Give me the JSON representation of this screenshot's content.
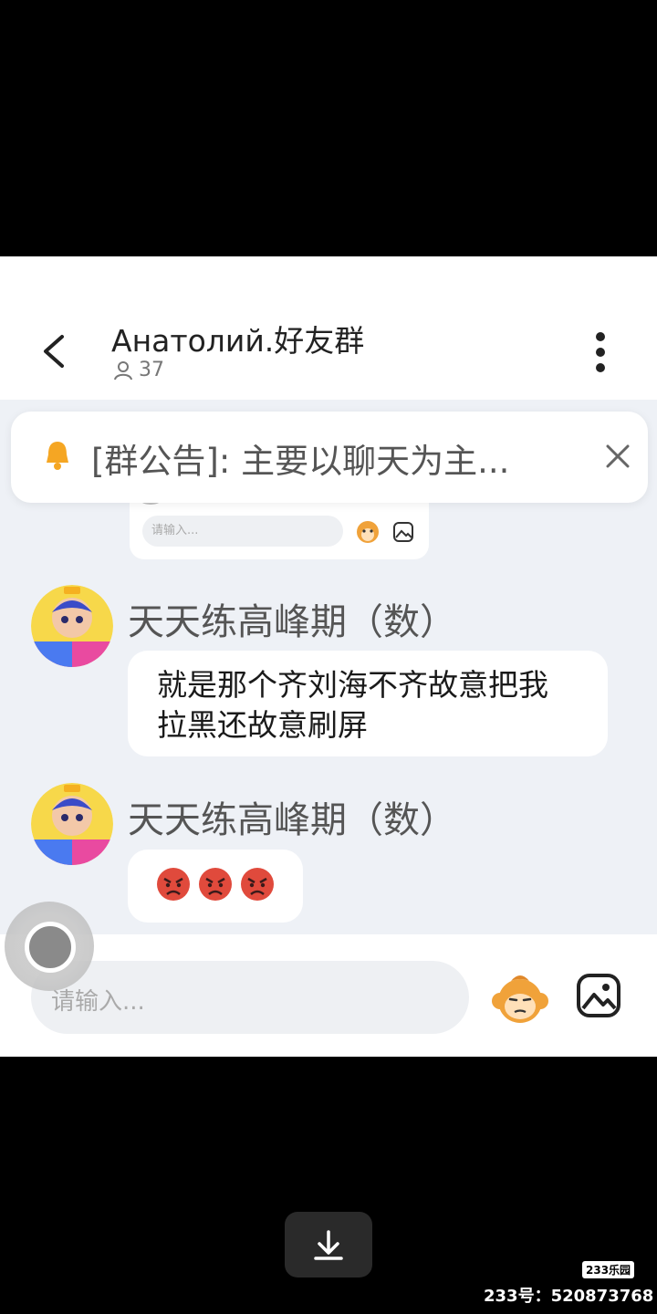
{
  "header": {
    "title": "Анатолий.好友群",
    "member_count": "37"
  },
  "notice": {
    "text": "[群公告]: 主要以聊天为主..."
  },
  "embedded_screenshot": {
    "input_placeholder": "请输入..."
  },
  "messages": [
    {
      "sender": "天天练高峰期（数）",
      "text": "就是那个齐刘海不齐故意把我\n拉黑还故意刷屏"
    },
    {
      "sender": "天天练高峰期（数）",
      "emoji_count": 3,
      "emoji": "angry-face"
    }
  ],
  "composer": {
    "placeholder": "请输入..."
  },
  "watermark": {
    "brand": "233乐园",
    "id_text": "233号：520873768"
  },
  "colors": {
    "chat_background": "#eef1f6",
    "angry_emoji": "#e04a3c",
    "accent_orange": "#f0a23a"
  }
}
